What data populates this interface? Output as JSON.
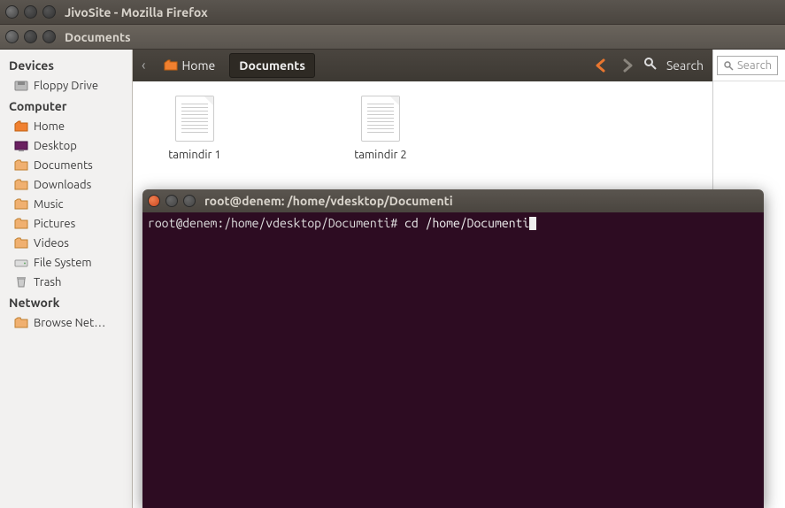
{
  "window1": {
    "title": "JivoSite - Mozilla Firefox"
  },
  "window2": {
    "title": "Documents"
  },
  "sidebar": {
    "headings": {
      "devices": "Devices",
      "computer": "Computer",
      "network": "Network"
    },
    "floppy": "Floppy Drive",
    "home": "Home",
    "desktop": "Desktop",
    "documents": "Documents",
    "downloads": "Downloads",
    "music": "Music",
    "pictures": "Pictures",
    "videos": "Videos",
    "filesystem": "File System",
    "trash": "Trash",
    "browse": "Browse Net…"
  },
  "breadcrumb": {
    "home": "Home",
    "documents": "Documents"
  },
  "toolbar": {
    "search_label": "Search",
    "search_placeholder": "Search"
  },
  "files": [
    {
      "name": "tamindir 1"
    },
    {
      "name": "tamindir 2"
    }
  ],
  "terminal": {
    "title": "root@denem: /home/vdesktop/Documenti",
    "prompt": "root@denem:/home/vdesktop/Documenti#",
    "command": "cd /home/Documenti"
  }
}
